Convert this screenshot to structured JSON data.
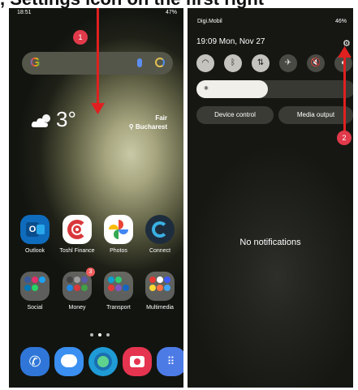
{
  "cropped_heading": ", Settings icon on the first right",
  "left_screen": {
    "status_time": "18:51",
    "status_right": "47%",
    "search_logo": "G",
    "weather": {
      "temperature": "3°",
      "condition": "Fair",
      "city": "Bucharest"
    },
    "apps_row1": [
      {
        "name": "Outlook",
        "color": "#0f6cbd",
        "icon": "outlook-icon"
      },
      {
        "name": "Toshl Finance",
        "color": "#ffffff",
        "icon": "toshl-finance-icon"
      },
      {
        "name": "Photos",
        "color": "#ffffff",
        "icon": "photos-icon"
      },
      {
        "name": "Connect",
        "color": "#1e2d3d",
        "icon": "connect-icon"
      }
    ],
    "apps_row2": [
      {
        "name": "Social",
        "icon": "social-folder-icon"
      },
      {
        "name": "Money",
        "icon": "money-folder-icon",
        "badge": "3"
      },
      {
        "name": "Transport",
        "icon": "transport-folder-icon"
      },
      {
        "name": "Multimedia",
        "icon": "multimedia-folder-icon"
      }
    ],
    "dock": [
      {
        "icon": "phone-icon",
        "color": "#2f76d8"
      },
      {
        "icon": "messages-icon",
        "color": "#3a8ff0"
      },
      {
        "icon": "edge-browser-icon",
        "color": "#1f9bd6"
      },
      {
        "icon": "camera-icon",
        "color": "#e5344f"
      },
      {
        "icon": "apps-drawer-icon",
        "color": "#4d7be6"
      }
    ],
    "annotation_number": "1"
  },
  "right_screen": {
    "carrier": "Digi.Mobil",
    "status_right": "46%",
    "datetime": "19:09  Mon, Nov 27",
    "tiles": [
      "wifi-icon",
      "bluetooth-icon",
      "data-transfer-icon",
      "airplane-mode-icon",
      "sound-off-icon",
      "extra-tile-icon"
    ],
    "device_control_label": "Device control",
    "media_output_label": "Media output",
    "empty_label": "No notifications",
    "annotation_number": "2"
  },
  "colors": {
    "annotation_red": "#e02020",
    "badge_red": "#e03a4b"
  }
}
